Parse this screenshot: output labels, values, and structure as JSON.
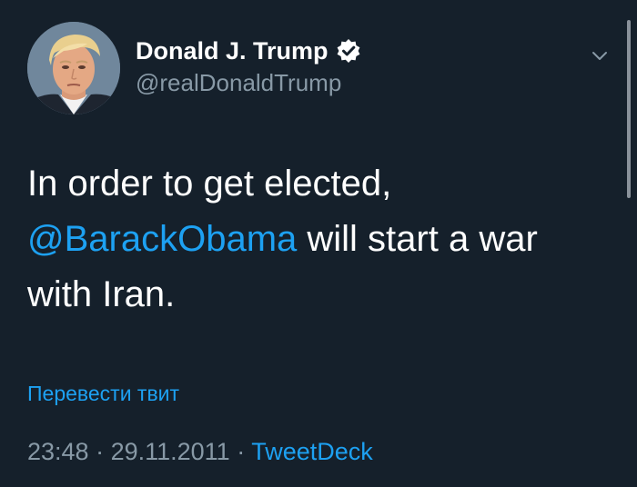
{
  "tweet": {
    "author_name": "Donald J. Trump",
    "handle": "@realDonaldTrump",
    "text_line_1": "In order to get elected,",
    "mention": "@BarackObama",
    "text_after_mention": " will start a war",
    "text_line_3": "with Iran.",
    "translate_label": "Перевести твит",
    "time": "23:48",
    "separator": " · ",
    "date": "29.11.2011",
    "source": "TweetDeck"
  },
  "icons": {
    "verified": "verified-badge-icon",
    "menu": "chevron-down-icon"
  },
  "colors": {
    "background": "#15202b",
    "primary_text": "#ffffff",
    "secondary_text": "#8899a6",
    "accent": "#1da1f2"
  }
}
